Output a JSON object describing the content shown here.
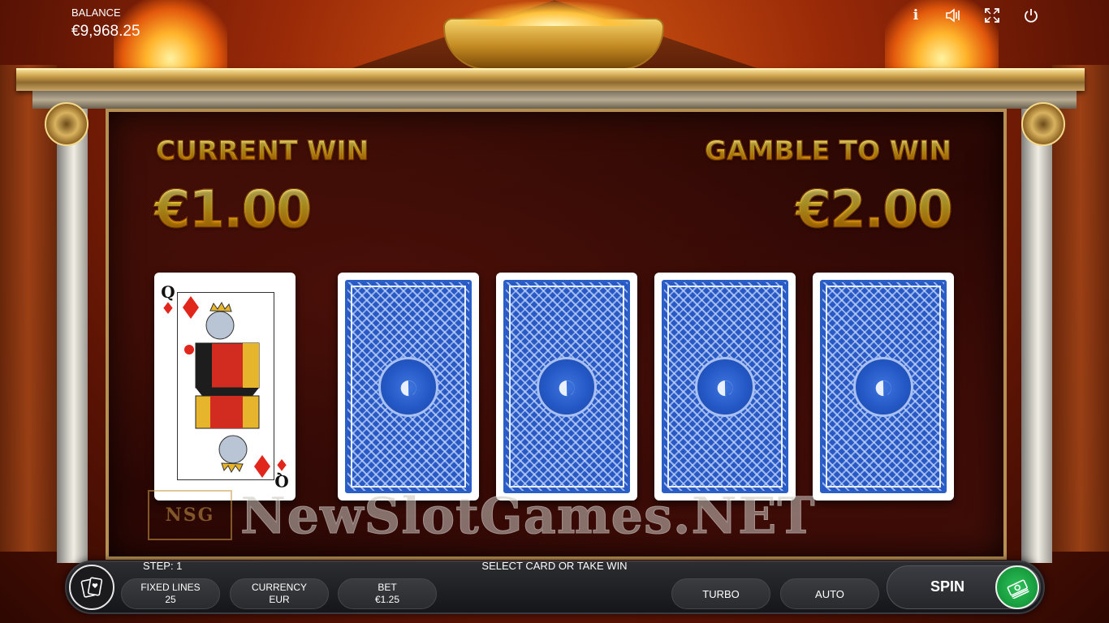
{
  "top_bar": {
    "balance_label": "BALANCE",
    "balance_value": "€9,968.25",
    "icons": [
      "info-icon",
      "sound-icon",
      "fullscreen-icon",
      "power-icon"
    ]
  },
  "gamble": {
    "current_win_label": "CURRENT WIN",
    "current_win_value": "€1.00",
    "gamble_to_win_label": "GAMBLE TO WIN",
    "gamble_to_win_value": "€2.00",
    "dealer_card": {
      "rank": "Q",
      "suit": "♦"
    },
    "face_down_cards": 4
  },
  "status": {
    "step": "STEP: 1",
    "message": "SELECT CARD OR TAKE WIN"
  },
  "controls": {
    "fixed_lines_label": "FIXED LINES",
    "fixed_lines_value": "25",
    "currency_label": "CURRENCY",
    "currency_value": "EUR",
    "bet_label": "BET",
    "bet_value": "€1.25",
    "turbo_label": "TURBO",
    "auto_label": "AUTO",
    "spin_label": "SPIN"
  },
  "watermark": {
    "logo": "NSG",
    "text": "NewSlotGames.NET"
  },
  "colors": {
    "gold": "#ffd633",
    "card_back_blue": "#2859c4",
    "take_win_green": "#169a3c",
    "suit_red": "#e1261c"
  }
}
